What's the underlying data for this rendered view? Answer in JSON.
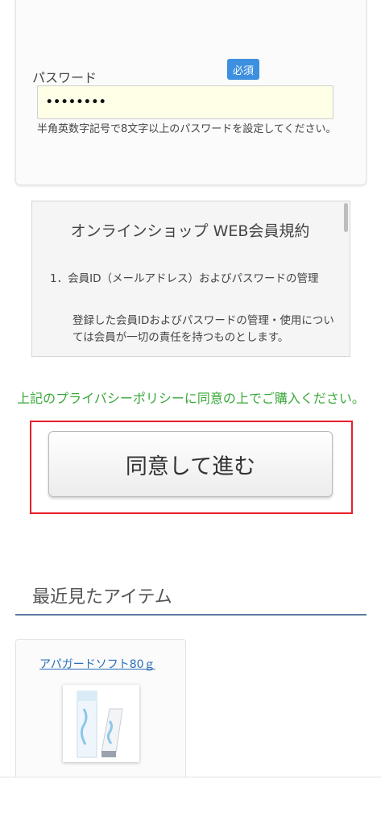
{
  "form": {
    "password_label": "パスワード",
    "required_badge": "必須",
    "password_value": "••••••••",
    "password_hint": "半角英数字記号で8文字以上のパスワードを設定してください。"
  },
  "terms": {
    "title": "オンラインショップ WEB会員規約",
    "section_1": "1．会員ID（メールアドレス）およびパスワードの管理",
    "section_1_body": "登録した会員IDおよびパスワードの管理・使用については会員が一切の責任を持つものとします。"
  },
  "privacy_note": "上記のプライバシーポリシーに同意の上でご購入ください。",
  "agree_button": "同意して進む",
  "recent": {
    "heading": "最近見たアイテム",
    "items": [
      {
        "name": "アパガードソフト80ｇ"
      }
    ]
  },
  "colors": {
    "accent_blue": "#3d8fe0",
    "note_green": "#3aa83a",
    "highlight_red": "#e8202a",
    "link_blue": "#2a6dbb"
  }
}
